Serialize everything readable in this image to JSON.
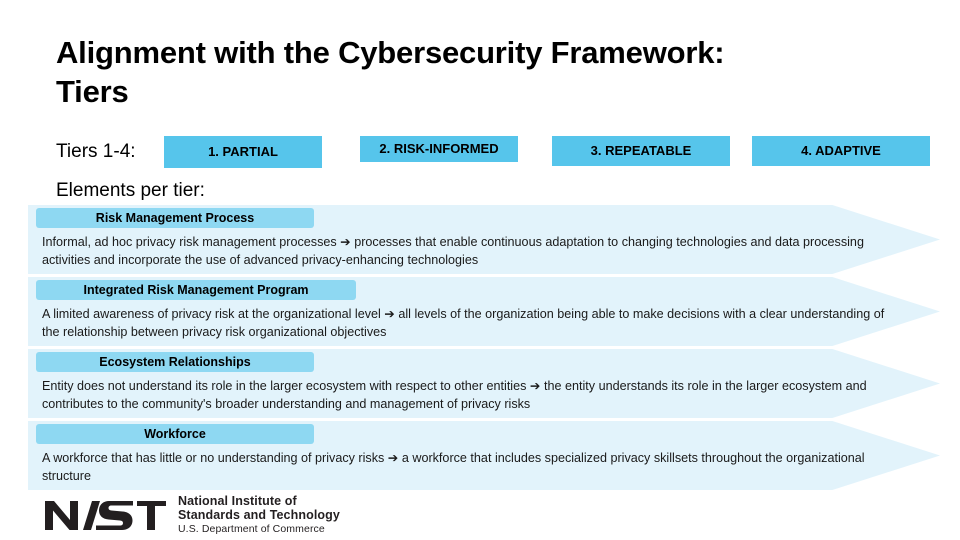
{
  "slide": {
    "title": "Alignment with the Cybersecurity Framework: Tiers",
    "tiers_label": "Tiers 1-4:",
    "elements_label": "Elements per tier:"
  },
  "colors": {
    "tier_box": "#56C5EB",
    "pill": "#8ED8F2",
    "chevron": "#E2F3FB",
    "text": "#000000"
  },
  "tiers": [
    {
      "label": "1. PARTIAL"
    },
    {
      "label": "2. RISK-INFORMED"
    },
    {
      "label": "3. REPEATABLE"
    },
    {
      "label": "4. ADAPTIVE"
    }
  ],
  "elements": [
    {
      "heading": "Risk Management Process",
      "body": "Informal, ad hoc privacy risk management processes ➔ processes that enable continuous adaptation to changing technologies and data processing activities and incorporate the use of advanced privacy-enhancing technologies"
    },
    {
      "heading": "Integrated Risk Management Program",
      "body": "A limited awareness of privacy risk at the organizational level ➔ all levels of the organization being able to make decisions with a clear understanding of the relationship between privacy risk organizational objectives"
    },
    {
      "heading": "Ecosystem Relationships",
      "body": "Entity does not understand its role in the larger ecosystem with respect to other entities ➔ the entity understands its role in the larger ecosystem and contributes to the community's broader understanding and management of privacy risks"
    },
    {
      "heading": "Workforce",
      "body": "A workforce that has little or no understanding of privacy risks ➔ a workforce that includes specialized privacy skillsets throughout the organizational structure"
    }
  ],
  "logo": {
    "wordmark": "NIST",
    "line1": "National Institute of",
    "line2": "Standards and Technology",
    "line3": "U.S. Department of Commerce"
  }
}
